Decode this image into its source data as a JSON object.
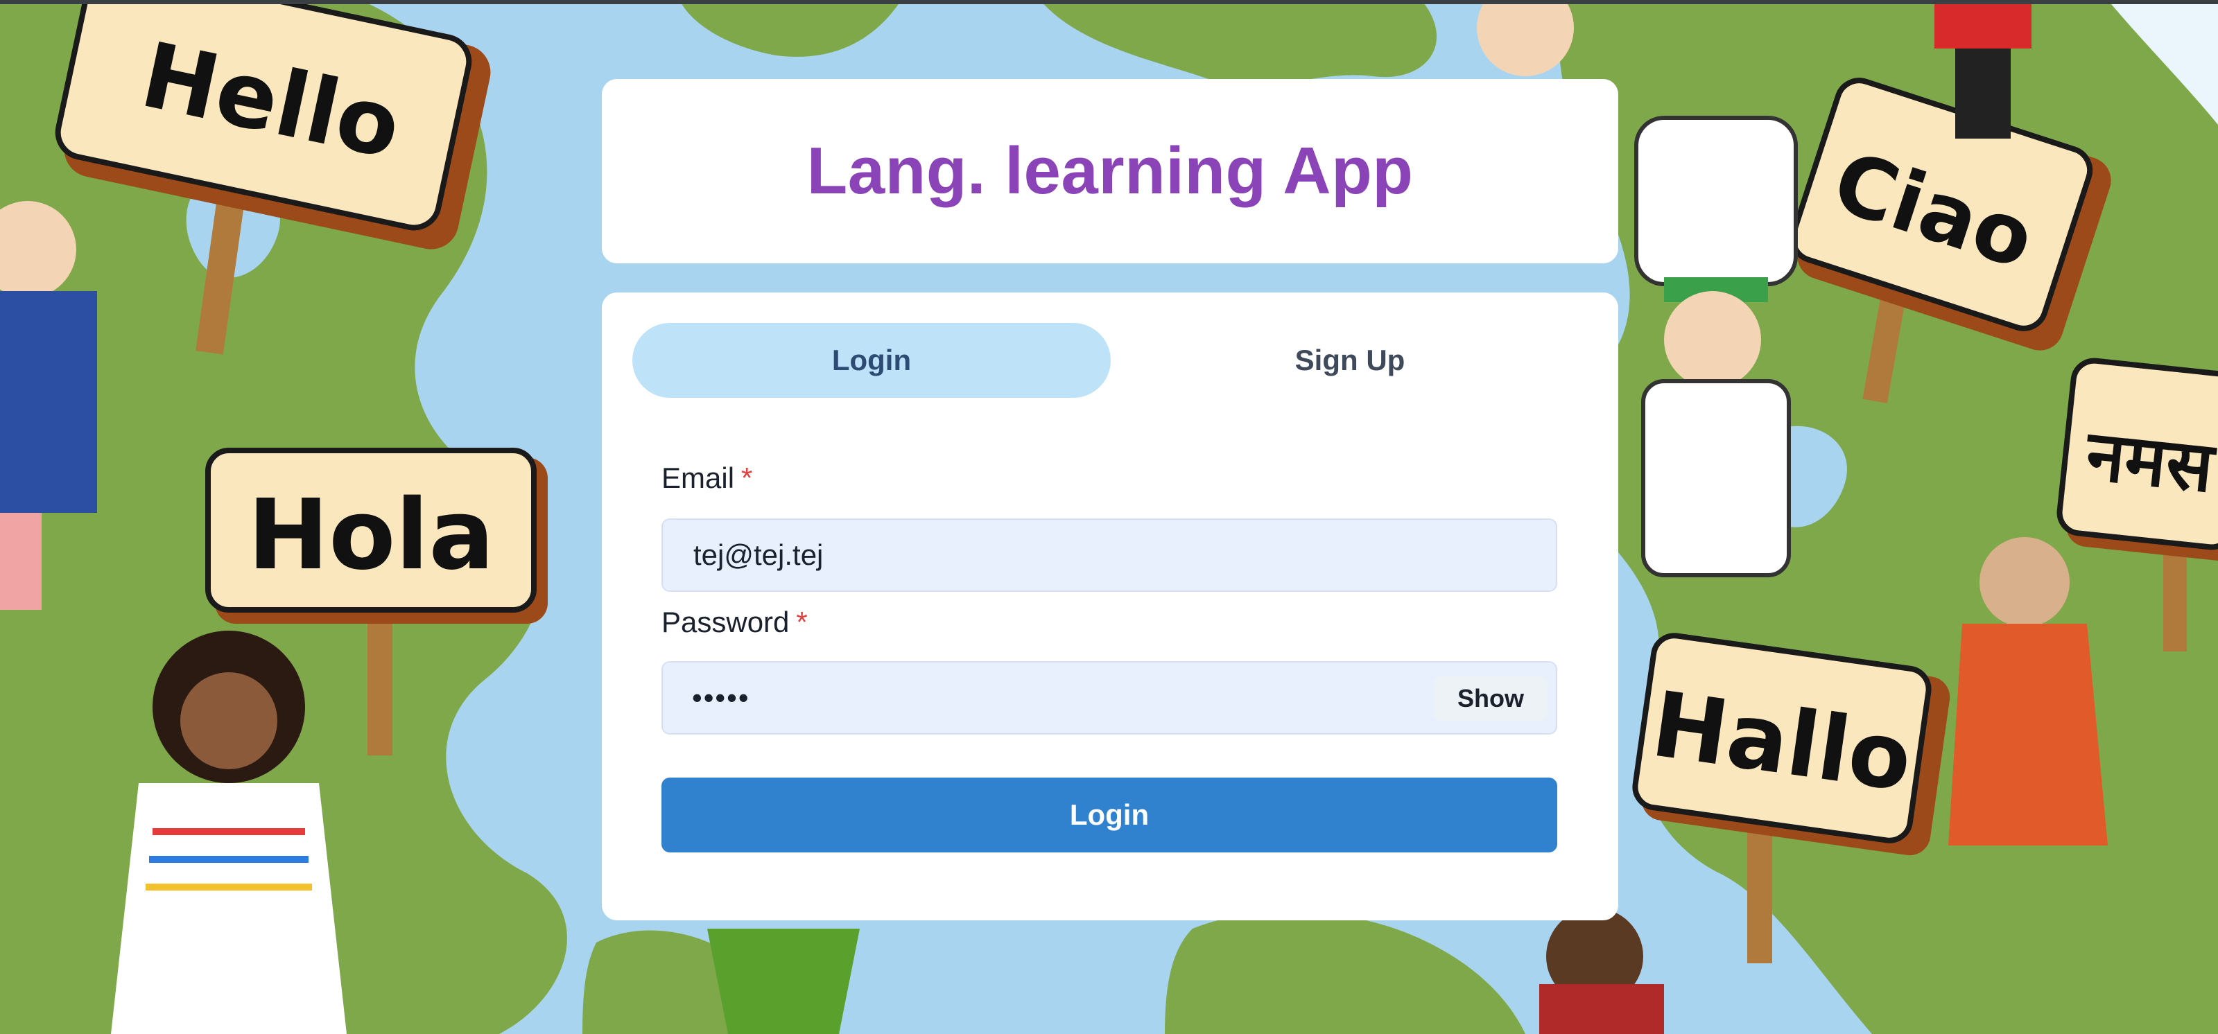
{
  "app": {
    "title": "Lang. learning App"
  },
  "tabs": [
    {
      "label": "Login",
      "active": true
    },
    {
      "label": "Sign Up",
      "active": false
    }
  ],
  "form": {
    "email_label": "Email",
    "email_required_marker": "*",
    "email_value": "tej@tej.tej",
    "password_label": "Password",
    "password_required_marker": "*",
    "password_masked": "•••••",
    "show_label": "Show",
    "submit_label": "Login"
  },
  "background": {
    "signs": [
      "Hello",
      "Hola",
      "Ciao",
      "Hallo",
      "नमस"
    ]
  },
  "colors": {
    "title": "#8a44b8",
    "active_tab": "#bee3f8",
    "input_bg": "#e8f0fe",
    "submit": "#3182ce",
    "required": "#e53e3e"
  },
  "icons": {
    "required": "asterisk"
  }
}
